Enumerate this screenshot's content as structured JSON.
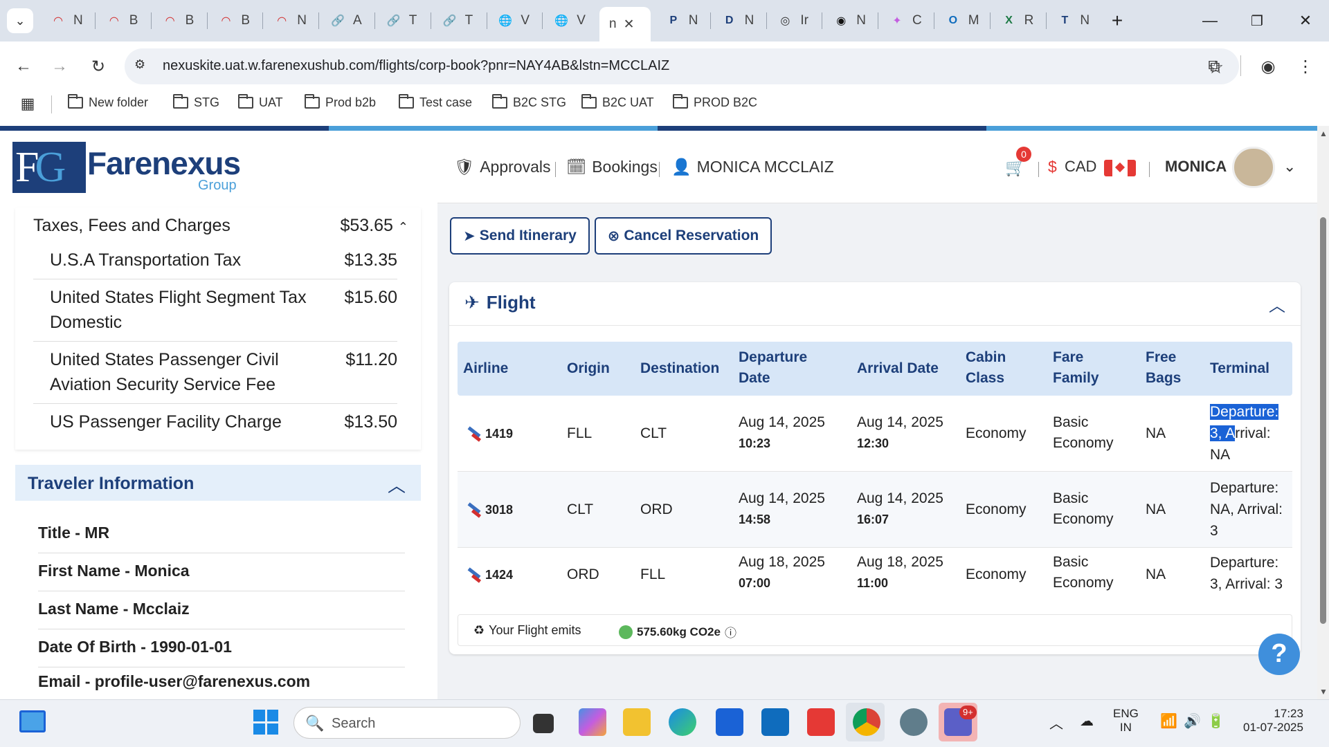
{
  "browser": {
    "tabs": [
      {
        "icon": "red-arc",
        "label": "N"
      },
      {
        "icon": "red-arc",
        "label": "B"
      },
      {
        "icon": "red-arc",
        "label": "B"
      },
      {
        "icon": "red-arc",
        "label": "B"
      },
      {
        "icon": "red-arc",
        "label": "N"
      },
      {
        "icon": "link",
        "label": "A"
      },
      {
        "icon": "link",
        "label": "T"
      },
      {
        "icon": "link",
        "label": "T"
      },
      {
        "icon": "globe",
        "label": "V"
      },
      {
        "icon": "globe",
        "label": "V"
      },
      {
        "icon": "text",
        "label": "n"
      },
      {
        "icon": "P",
        "label": "N"
      },
      {
        "icon": "D",
        "label": "N"
      },
      {
        "icon": "openai",
        "label": "Ir"
      },
      {
        "icon": "openai-dark",
        "label": "N"
      },
      {
        "icon": "copilot",
        "label": "C"
      },
      {
        "icon": "outlook",
        "label": "M"
      },
      {
        "icon": "excel",
        "label": "R"
      },
      {
        "icon": "T",
        "label": "N"
      }
    ],
    "url": "nexuskite.uat.w.farenexushub.com/flights/corp-book?pnr=NAY4AB&lstn=MCCLAIZ",
    "bookmarks": [
      "New folder",
      "STG",
      "UAT",
      "Prod b2b",
      "Test case",
      "B2C STG",
      "B2C UAT",
      "PROD B2C"
    ]
  },
  "brand": {
    "monogram_f": "F",
    "monogram_g": "G",
    "name": "Farenexus",
    "sub": "Group"
  },
  "header": {
    "approvals": "Approvals",
    "bookings": "Bookings",
    "user": "MONICA MCCLAIZ",
    "cart_count": "0",
    "currency_symbol": "$",
    "currency": "CAD",
    "profile_name": "MONICA"
  },
  "fees": {
    "title": "Taxes, Fees and Charges",
    "total": "$53.65",
    "items": [
      {
        "name": "U.S.A Transportation Tax",
        "amount": "$13.35"
      },
      {
        "name": "United States Flight Segment Tax Domestic",
        "amount": "$15.60"
      },
      {
        "name": "United States Passenger Civil Aviation Security Service Fee",
        "amount": "$11.20"
      },
      {
        "name": "US Passenger Facility Charge",
        "amount": "$13.50"
      }
    ]
  },
  "traveler": {
    "title": "Traveler Information",
    "fields": [
      "Title - MR",
      "First Name - Monica",
      "Last Name - Mcclaiz",
      "Date Of Birth - 1990-01-01",
      "Email - profile-user@farenexus.com"
    ]
  },
  "actions": {
    "send": "Send Itinerary",
    "cancel": "Cancel Reservation"
  },
  "flight": {
    "title": "Flight",
    "columns": {
      "airline": "Airline",
      "origin": "Origin",
      "destination": "Destination",
      "dep_l1": "Departure",
      "dep_l2": "Date",
      "arrival": "Arrival Date",
      "cabin_l1": "Cabin",
      "cabin_l2": "Class",
      "fare_l1": "Fare",
      "fare_l2": "Family",
      "bags_l1": "Free",
      "bags_l2": "Bags",
      "terminal": "Terminal"
    },
    "rows": [
      {
        "flight": "1419",
        "origin": "FLL",
        "destination": "CLT",
        "dep_date": "Aug 14, 2025",
        "dep_time": "10:23",
        "arr_date": "Aug 14, 2025",
        "arr_time": "12:30",
        "cabin": "Economy",
        "fare_l1": "Basic",
        "fare_l2": "Economy",
        "bags": "NA",
        "term_l1": "Departure:",
        "term_l2a": "3, A",
        "term_l2b": "rrival:",
        "term_l3": "NA"
      },
      {
        "flight": "3018",
        "origin": "CLT",
        "destination": "ORD",
        "dep_date": "Aug 14, 2025",
        "dep_time": "14:58",
        "arr_date": "Aug 14, 2025",
        "arr_time": "16:07",
        "cabin": "Economy",
        "fare_l1": "Basic",
        "fare_l2": "Economy",
        "bags": "NA",
        "term_l1": "Departure:",
        "term_l2": "NA, Arrival:",
        "term_l3": "3"
      },
      {
        "flight": "1424",
        "origin": "ORD",
        "destination": "FLL",
        "dep_date": "Aug 18, 2025",
        "dep_time": "07:00",
        "arr_date": "Aug 18, 2025",
        "arr_time": "11:00",
        "cabin": "Economy",
        "fare_l1": "Basic",
        "fare_l2": "Economy",
        "bags": "NA",
        "term_l1": "Departure:",
        "term_l2": "3, Arrival: 3"
      }
    ],
    "emits_label": "Your Flight emits",
    "emits_value": "575.60kg CO2e"
  },
  "help": "?",
  "taskbar": {
    "search": "Search",
    "lang1": "ENG",
    "lang2": "IN",
    "time": "17:23",
    "date": "01-07-2025",
    "teams_badge": "9+"
  },
  "colors": {
    "brand": "#1d3f7a",
    "accent": "#4a9fd9",
    "header_bg": "#d7e6f7",
    "selection": "#1a62d6"
  }
}
